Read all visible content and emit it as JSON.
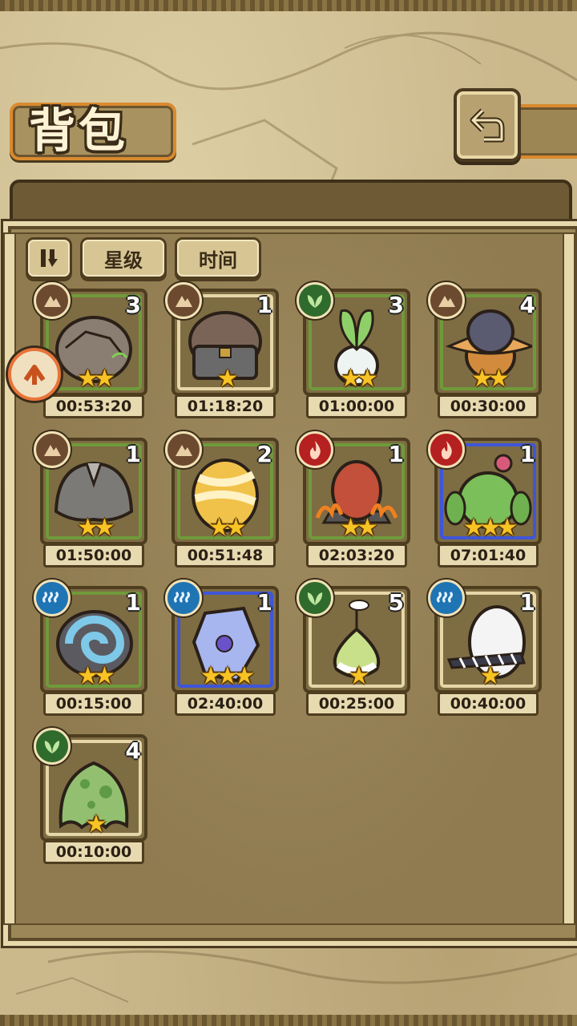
{
  "header": {
    "title": "背包"
  },
  "toolbar": {
    "sort_toggle_icon": "pause-bars-icon",
    "sort_star_label": "星级",
    "sort_time_label": "时间"
  },
  "colors": {
    "accent": "#d98a2e",
    "parchment": "#cbb98c",
    "frame_green": "#6f9a3a",
    "frame_blue": "#3f56d8",
    "star": "#f7c325"
  },
  "items": [
    {
      "name": "rock-egg",
      "element": "earth",
      "count": "3",
      "stars": 2,
      "time": "00:53:20",
      "frame": "green"
    },
    {
      "name": "helmet-egg",
      "element": "earth",
      "count": "1",
      "stars": 1,
      "time": "01:18:20",
      "frame": "tan"
    },
    {
      "name": "turnip-egg",
      "element": "leaf",
      "count": "3",
      "stars": 2,
      "time": "01:00:00",
      "frame": "green"
    },
    {
      "name": "witch-hat-egg",
      "element": "earth",
      "count": "4",
      "stars": 2,
      "time": "00:30:00",
      "frame": "green"
    },
    {
      "name": "furry-egg",
      "element": "earth",
      "count": "1",
      "stars": 2,
      "time": "01:50:00",
      "frame": "green"
    },
    {
      "name": "bandaged-egg",
      "element": "earth",
      "count": "2",
      "stars": 2,
      "time": "00:51:48",
      "frame": "green"
    },
    {
      "name": "lava-egg",
      "element": "fire",
      "count": "1",
      "stars": 2,
      "time": "02:03:20",
      "frame": "green"
    },
    {
      "name": "cactus-egg",
      "element": "fire",
      "count": "1",
      "stars": 3,
      "time": "07:01:40",
      "frame": "blue"
    },
    {
      "name": "shell-egg",
      "element": "water",
      "count": "1",
      "stars": 2,
      "time": "00:15:00",
      "frame": "green"
    },
    {
      "name": "crystal-egg",
      "element": "water",
      "count": "1",
      "stars": 3,
      "time": "02:40:00",
      "frame": "blue"
    },
    {
      "name": "bulb-egg",
      "element": "leaf",
      "count": "5",
      "stars": 1,
      "time": "00:25:00",
      "frame": "tan"
    },
    {
      "name": "feather-egg",
      "element": "water",
      "count": "1",
      "stars": 1,
      "time": "00:40:00",
      "frame": "tan"
    },
    {
      "name": "slime-egg",
      "element": "leaf",
      "count": "4",
      "stars": 1,
      "time": "00:10:00",
      "frame": "tan"
    }
  ]
}
